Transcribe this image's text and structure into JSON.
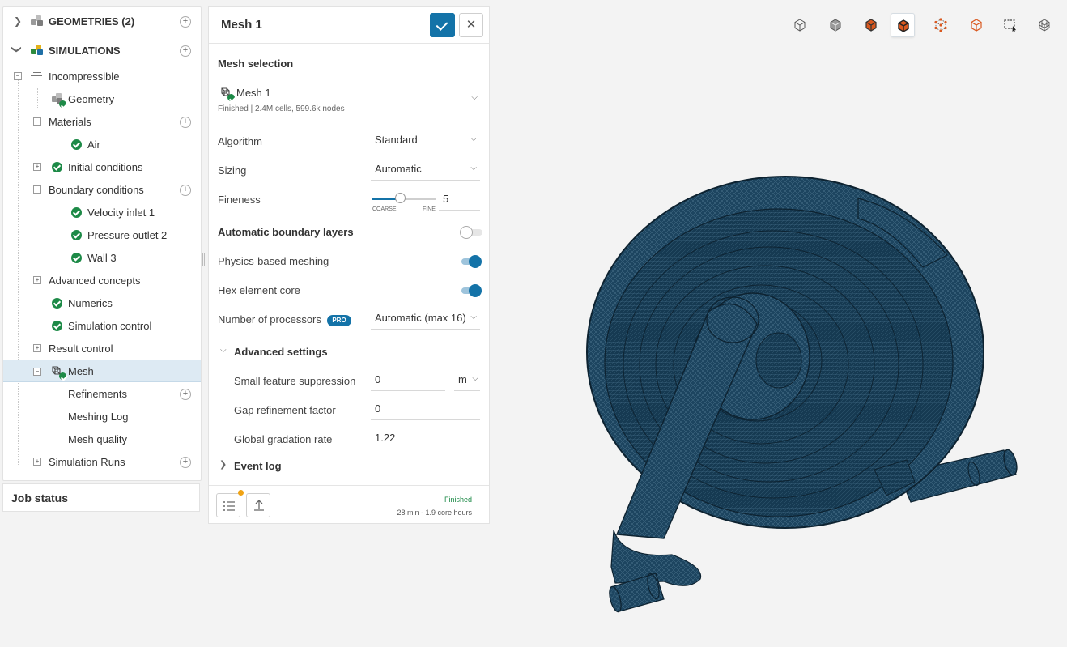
{
  "tree": {
    "geometries_label": "GEOMETRIES (2)",
    "simulations_label": "SIMULATIONS",
    "items": {
      "incompressible": "Incompressible",
      "geometry": "Geometry",
      "materials": "Materials",
      "air": "Air",
      "initial_conditions": "Initial conditions",
      "boundary_conditions": "Boundary conditions",
      "velocity_inlet": "Velocity inlet 1",
      "pressure_outlet": "Pressure outlet 2",
      "wall": "Wall 3",
      "advanced_concepts": "Advanced concepts",
      "numerics": "Numerics",
      "simulation_control": "Simulation control",
      "result_control": "Result control",
      "mesh": "Mesh",
      "refinements": "Refinements",
      "meshing_log": "Meshing Log",
      "mesh_quality": "Mesh quality",
      "simulation_runs": "Simulation Runs"
    },
    "selected": "Mesh"
  },
  "job_status": {
    "label": "Job status"
  },
  "mesh_panel": {
    "title": "Mesh 1",
    "selection_heading": "Mesh selection",
    "selected_mesh": {
      "name": "Mesh 1",
      "details": "Finished | 2.4M cells, 599.6k nodes"
    },
    "algorithm": {
      "label": "Algorithm",
      "value": "Standard"
    },
    "sizing": {
      "label": "Sizing",
      "value": "Automatic"
    },
    "fineness": {
      "label": "Fineness",
      "value": "5",
      "min_label": "COARSE",
      "max_label": "FINE",
      "level": 0.44
    },
    "auto_boundary_layers": {
      "label": "Automatic boundary layers",
      "on": false
    },
    "physics_based_meshing": {
      "label": "Physics-based meshing",
      "on": true
    },
    "hex_element_core": {
      "label": "Hex element core",
      "on": true
    },
    "processors": {
      "label": "Number of processors",
      "badge": "PRO",
      "value": "Automatic (max 16)"
    },
    "advanced_settings": {
      "label": "Advanced settings",
      "small_feature_suppression": {
        "label": "Small feature suppression",
        "value": "0",
        "unit": "m"
      },
      "gap_refinement_factor": {
        "label": "Gap refinement factor",
        "value": "0"
      },
      "global_gradation_rate": {
        "label": "Global gradation rate",
        "value": "1.22"
      }
    },
    "event_log": {
      "label": "Event log"
    },
    "footer": {
      "status": "Finished",
      "runtime": "28 min - 1.9 core hours"
    }
  },
  "toolbar": {
    "icons": [
      "cube-outline-icon",
      "cube-solid-icon",
      "cube-solid-edges-icon",
      "cube-surface-icon",
      "cube-points-icon",
      "cube-wireframe-icon",
      "box-select-icon",
      "mesh-cube-icon"
    ],
    "active": "cube-surface-icon"
  },
  "colors": {
    "accent": "#1473a8",
    "success": "#1d8a47",
    "mesh": "#1d4560",
    "orange": "#d9581f"
  }
}
